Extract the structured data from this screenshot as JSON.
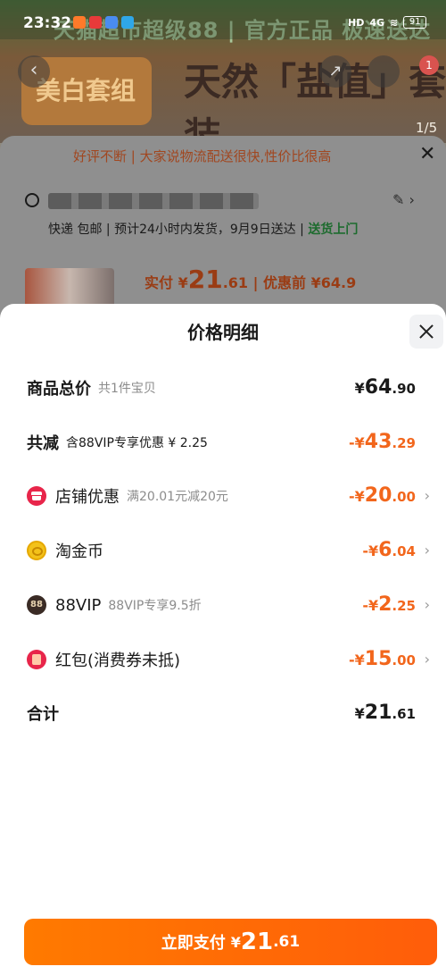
{
  "status_bar": {
    "time": "23:32",
    "hd": "HD",
    "network": "4G",
    "battery": "91"
  },
  "background": {
    "banner_text": "天猫超市超级88 | 官方正品 极速送达",
    "product_title": "天然「盐值」套装",
    "promo_card": "美白套组",
    "pager": "1/5",
    "cart_badge": "1",
    "notice": "好评不断 | 大家说物流配送很快,性价比很高",
    "shipping_text": "快递 包邮 | 预计24小时内发货，9月9日送达 |",
    "shipping_highlight": "送货上门",
    "price_prefix": "实付 ¥",
    "price_int": "21",
    "price_dec": ".61",
    "price_before": "| 优惠前 ¥64.9"
  },
  "sheet": {
    "title": "价格明细",
    "rows": [
      {
        "label": "商品总价",
        "sub": "共1件宝贝",
        "currency": "¥",
        "int": "64",
        "dec": ".90"
      },
      {
        "label": "共减",
        "sub": "含88VIP专享优惠 ¥ 2.25",
        "currency": "-¥",
        "int": "43",
        "dec": ".29"
      },
      {
        "label": "店铺优惠",
        "sub": "满20.01元减20元",
        "currency": "-¥",
        "int": "20",
        "dec": ".00"
      },
      {
        "label": "淘金币",
        "sub": "",
        "currency": "-¥",
        "int": "6",
        "dec": ".04"
      },
      {
        "label": "88VIP",
        "sub": "88VIP专享9.5折",
        "currency": "-¥",
        "int": "2",
        "dec": ".25",
        "icon_text": "88"
      },
      {
        "label": "红包(消费券未抵)",
        "sub": "",
        "currency": "-¥",
        "int": "15",
        "dec": ".00"
      },
      {
        "label": "合计",
        "sub": "",
        "currency": "¥",
        "int": "21",
        "dec": ".61"
      }
    ],
    "pay_button": {
      "label": "立即支付",
      "currency": "¥",
      "int": "21",
      "dec": ".61"
    }
  },
  "icons": [
    "shop-icon",
    "gold-coin-icon",
    "vip-icon",
    "red-packet-icon",
    "close-icon",
    "chevron-right-icon"
  ],
  "colors": {
    "accent": "#ff6a00",
    "discount": "#f2661c",
    "shop_red": "#e8254a"
  }
}
